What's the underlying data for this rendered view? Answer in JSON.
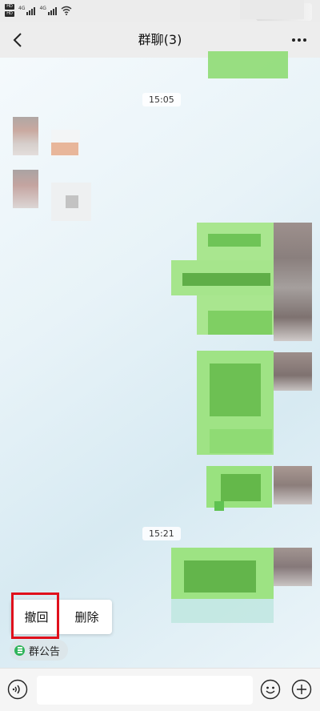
{
  "status_bar": {
    "hd_labels": [
      "HD",
      "HD"
    ],
    "network_labels": [
      "4G",
      "4G"
    ],
    "alarm_icon": "alarm-icon",
    "wifi_icon": "wifi-icon"
  },
  "header": {
    "title": "群聊(3)",
    "back_icon": "back-arrow-icon",
    "more_icon": "more-icon"
  },
  "timestamps": [
    "15:05",
    "15:21"
  ],
  "context_menu": {
    "items": [
      {
        "label": "撤回"
      },
      {
        "label": "删除"
      }
    ],
    "highlight_color": "#e0101c"
  },
  "announcement": {
    "label": "群公告",
    "icon": "announcement-icon",
    "accent": "#30b45a"
  },
  "input_bar": {
    "value": "",
    "voice_icon": "voice-icon",
    "emoji_icon": "emoji-icon",
    "plus_icon": "plus-icon"
  },
  "colors": {
    "nav_bg": "#ededed",
    "sent_bubble": "#95ec69"
  }
}
